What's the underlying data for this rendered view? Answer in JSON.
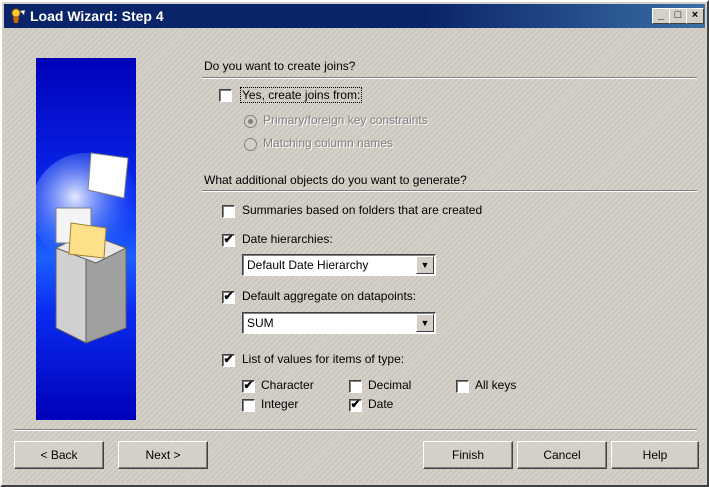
{
  "window": {
    "title": "Load Wizard: Step 4",
    "controls": {
      "minimize": "_",
      "maximize": "□",
      "close": "×"
    }
  },
  "joins": {
    "question": "Do you want to create joins?",
    "create_joins": {
      "label": "Yes, create joins from:",
      "checked": false
    },
    "options": [
      {
        "label": "Primary/foreign key constraints",
        "selected": true,
        "enabled": false
      },
      {
        "label": "Matching column names",
        "selected": false,
        "enabled": false
      }
    ]
  },
  "objects": {
    "question": "What additional objects do you want to generate?",
    "summaries": {
      "label": "Summaries based on folders that are created",
      "checked": false
    },
    "date_hierarchies": {
      "label": "Date hierarchies:",
      "checked": true,
      "selected_value": "Default Date Hierarchy"
    },
    "default_aggregate": {
      "label": "Default aggregate on datapoints:",
      "checked": true,
      "selected_value": "SUM"
    },
    "list_of_values": {
      "label": "List of values for items of type:",
      "checked": true
    },
    "types": {
      "character": {
        "label": "Character",
        "checked": true
      },
      "decimal": {
        "label": "Decimal",
        "checked": false
      },
      "all_keys": {
        "label": "All keys",
        "checked": false
      },
      "integer": {
        "label": "Integer",
        "checked": false
      },
      "date": {
        "label": "Date",
        "checked": true
      }
    }
  },
  "buttons": {
    "back": "< Back",
    "next": "Next >",
    "finish": "Finish",
    "cancel": "Cancel",
    "help": "Help"
  },
  "icons": {
    "app": "wizard-icon",
    "check": "✔",
    "dropdown": "▼"
  },
  "colors": {
    "title_bar": "#0a246a",
    "face": "#d4d0c8",
    "art_blue": "#0a2cf0"
  }
}
